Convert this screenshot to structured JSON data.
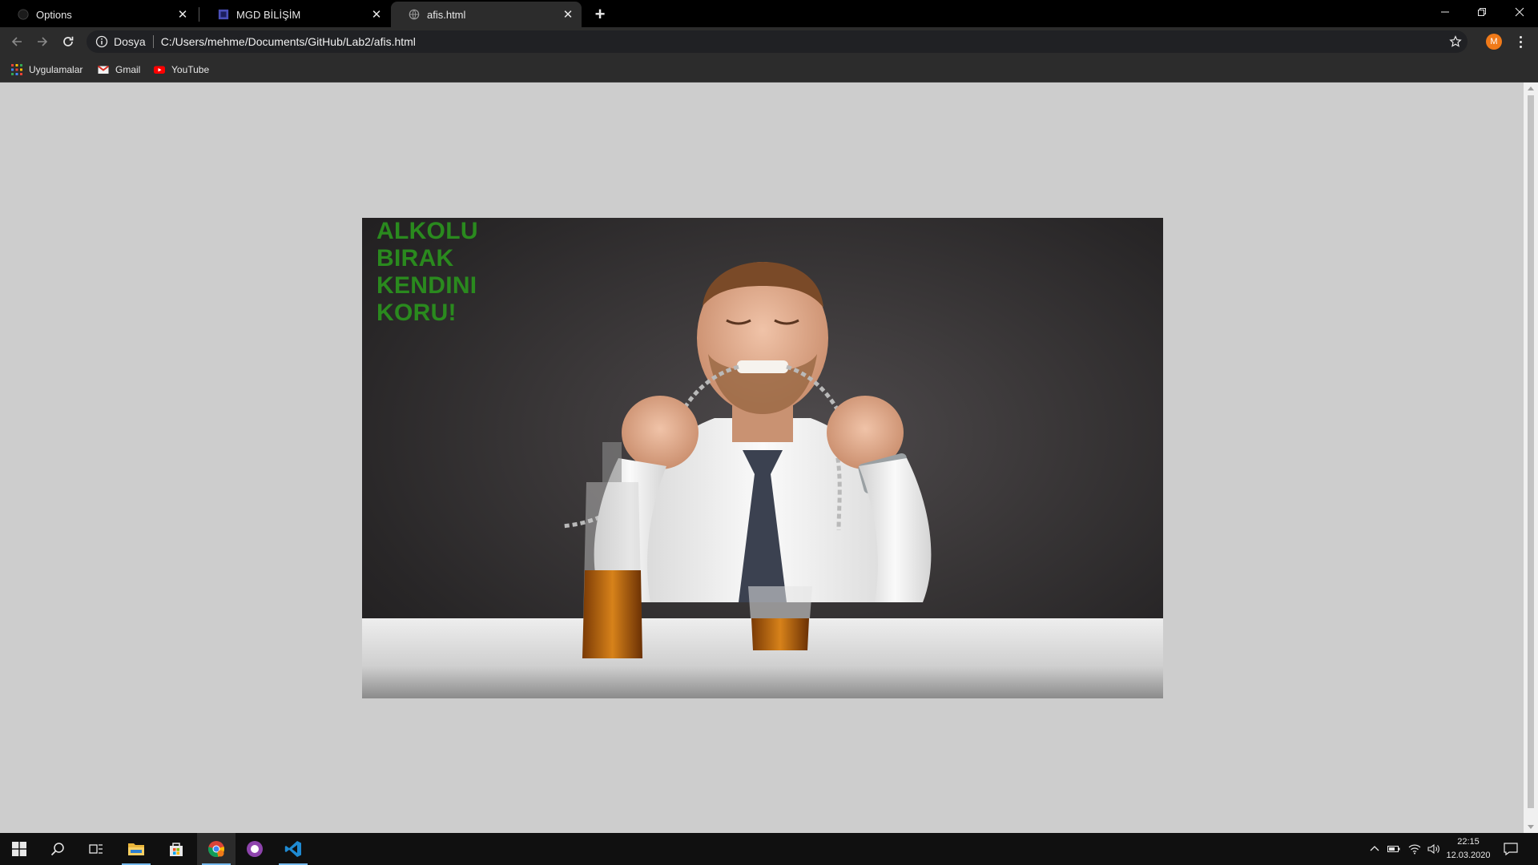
{
  "browser": {
    "tabs": [
      {
        "title": "Options",
        "favicon": "github-icon",
        "active": false
      },
      {
        "title": "MGD BİLİŞİM",
        "favicon": "site-square-icon",
        "active": false
      },
      {
        "title": "afis.html",
        "favicon": "globe-icon",
        "active": true
      }
    ],
    "new_tab_label": "+",
    "close_glyph": "✕",
    "address_bar": {
      "scheme_label": "Dosya",
      "url": "C:/Users/mehme/Documents/GitHub/Lab2/afis.html"
    },
    "profile_initial": "M",
    "bookmarks": [
      {
        "label": "Uygulamalar",
        "icon": "apps-grid-icon"
      },
      {
        "label": "Gmail",
        "icon": "gmail-icon"
      },
      {
        "label": "YouTube",
        "icon": "youtube-icon"
      }
    ]
  },
  "page": {
    "poster": {
      "lines": [
        "ALKOLU",
        "BIRAK",
        "KENDINI",
        "KORU!"
      ],
      "text_color": "#2a8a1e"
    },
    "background_color": "#cdcdcd"
  },
  "taskbar": {
    "apps": [
      "start-icon",
      "search-icon",
      "task-view-icon",
      "file-explorer-icon",
      "store-icon",
      "chrome-icon",
      "github-desktop-icon",
      "vscode-icon"
    ],
    "clock": {
      "time": "22:15",
      "date": "12.03.2020"
    }
  },
  "colors": {
    "titlebar": "#000000",
    "toolbar": "#2c2c2c",
    "accent_orange": "#f07a19",
    "taskbar": "#101010"
  }
}
